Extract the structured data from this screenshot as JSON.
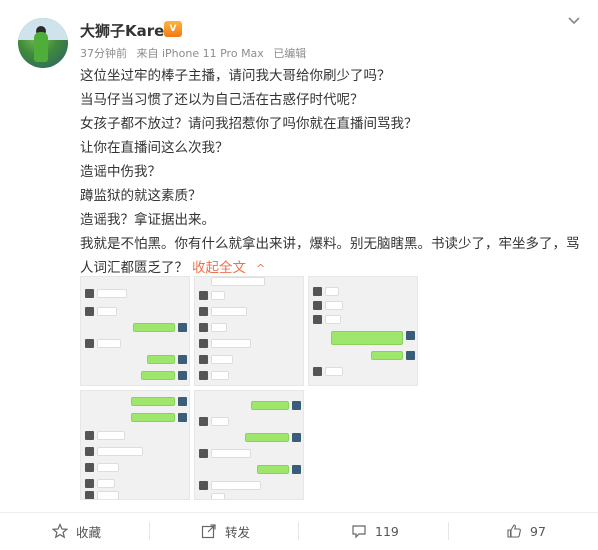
{
  "author": {
    "name": "大狮子Karen",
    "badge": "V",
    "time": "37分钟前",
    "source": "来自 iPhone 11 Pro Max",
    "edited": "已编辑"
  },
  "post": {
    "lines": [
      "这位坐过牢的棒子主播，请问我大哥给你刷少了吗？",
      "当马仔当习惯了还以为自己活在古惑仔时代呢？",
      "女孩子都不放过？请问我招惹你了吗你就在直播间骂我？",
      "让你在直播间这么次我？",
      "造谣中伤我？",
      "蹲监狱的就这素质？",
      "造谣我？拿证据出来。"
    ],
    "last_paragraph": "我就是不怕黑。你有什么就拿出来讲，爆料。别无脑瞎黑。书读少了，牢坐多了，骂人词汇都匮乏了？",
    "collapse_label": "收起全文",
    "collapse_caret": "^"
  },
  "actions": {
    "favorite": "收藏",
    "repost": "转发",
    "comments": "119",
    "likes": "97"
  },
  "colors": {
    "accent": "#eb7350",
    "meta": "#8c8c8c",
    "wechat_green": "#9fe66d"
  }
}
